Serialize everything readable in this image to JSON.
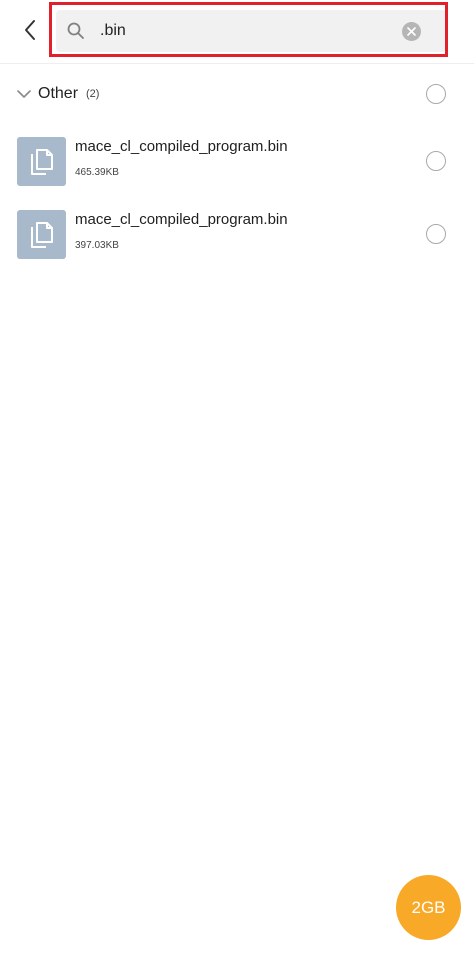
{
  "search": {
    "value": ".bin",
    "back_icon": "chevron-left-icon",
    "search_icon": "magnifier-icon",
    "clear_icon": "clear-circle-icon",
    "highlight_color": "#e0202a"
  },
  "group": {
    "title": "Other",
    "count": "(2)",
    "expand_icon": "chevron-down-icon"
  },
  "files": [
    {
      "name": "mace_cl_compiled_program.bin",
      "size": "465.39KB",
      "icon": "file-copy-icon"
    },
    {
      "name": "mace_cl_compiled_program.bin",
      "size": "397.03KB",
      "icon": "file-copy-icon"
    }
  ],
  "fab": {
    "label": "2GB",
    "color": "#f8a928"
  }
}
